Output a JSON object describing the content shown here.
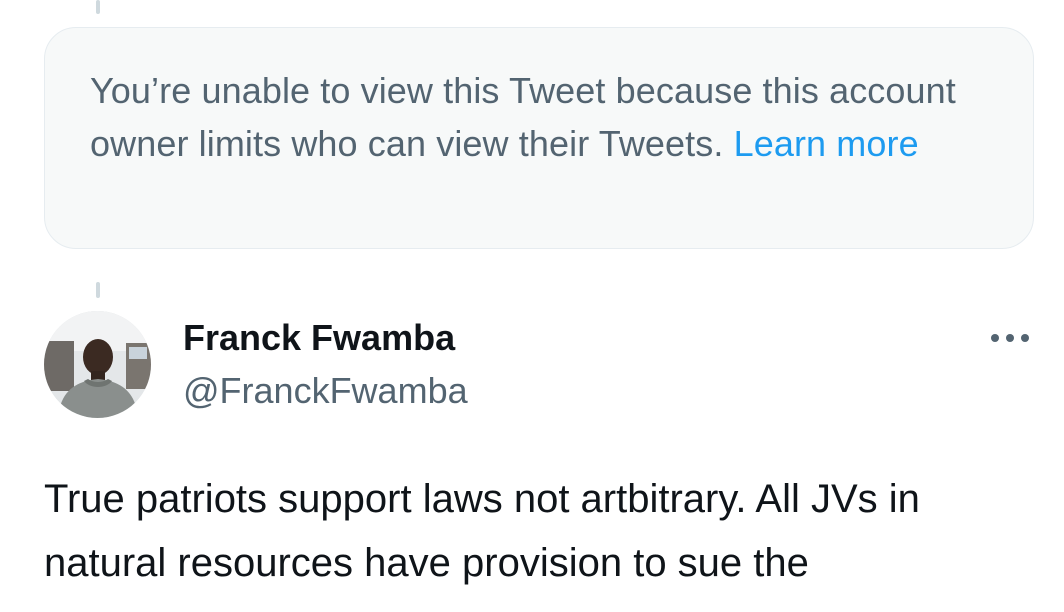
{
  "colors": {
    "secondary_text": "#536471",
    "link": "#1d9bf0",
    "primary_text": "#0f1419",
    "notice_bg": "#f7f9f9"
  },
  "restricted_notice": {
    "message": "You’re unable to view this Tweet because this account owner limits who can view their Tweets.",
    "link_label": "Learn more"
  },
  "tweet": {
    "author": {
      "display_name": "Franck Fwamba",
      "handle": "@FranckFwamba",
      "avatar_icon": "avatar-photo"
    },
    "more_icon": "more-horizontal-icon",
    "text": "True patriots support laws not artbitrary. All JVs in natural resources have provision to sue the"
  }
}
